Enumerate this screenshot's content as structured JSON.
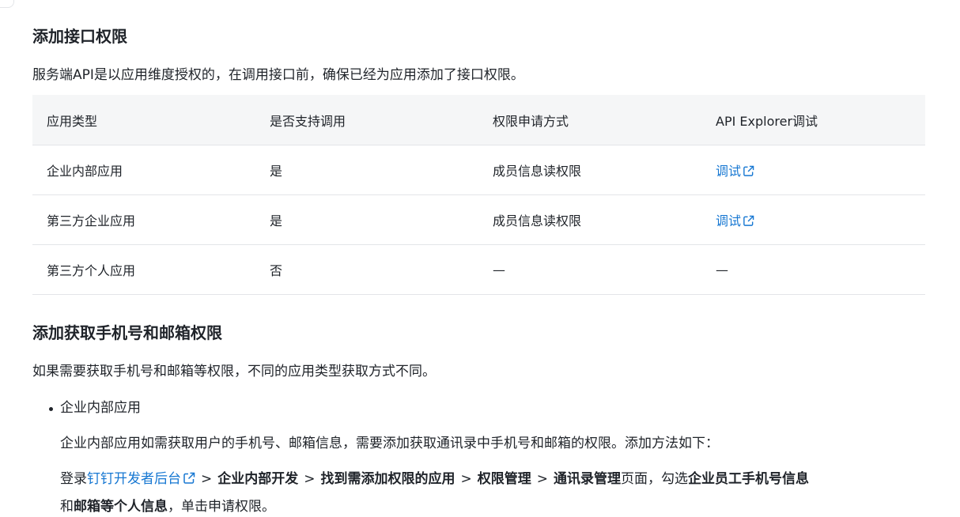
{
  "section1": {
    "title": "添加接口权限",
    "desc": "服务端API是以应用维度授权的，在调用接口前，确保已经为应用添加了接口权限。"
  },
  "table": {
    "headers": [
      "应用类型",
      "是否支持调用",
      "权限申请方式",
      "API Explorer调试"
    ],
    "rows": [
      {
        "type": "企业内部应用",
        "supported": "是",
        "method": "成员信息读权限",
        "debug": "调试",
        "debug_is_link": true
      },
      {
        "type": "第三方企业应用",
        "supported": "是",
        "method": "成员信息读权限",
        "debug": "调试",
        "debug_is_link": true
      },
      {
        "type": "第三方个人应用",
        "supported": "否",
        "method": "—",
        "debug": "—",
        "debug_is_link": false
      }
    ]
  },
  "section2": {
    "title": "添加获取手机号和邮箱权限",
    "desc": "如果需要获取手机号和邮箱等权限，不同的应用类型获取方式不同。",
    "bullet": "企业内部应用",
    "bullet_desc": "企业内部应用如需获取用户的手机号、邮箱信息，需要添加获取通讯录中手机号和邮箱的权限。添加方法如下：",
    "step": {
      "prefix": "登录",
      "link": "钉钉开发者后台",
      "sep": ">",
      "path1": "企业内部开发",
      "path2": "找到需添加权限的应用",
      "path3": "权限管理",
      "path4": "通讯录管理",
      "mid": "页面，勾选",
      "bold1": "企业员工手机号信息",
      "and": "和",
      "bold2": "邮箱等个人信息",
      "suffix": "，单击申请权限。"
    }
  },
  "colors": {
    "link": "#1677d2",
    "text": "#1f2329",
    "header_bg": "#f5f6f7",
    "border": "#e3e5e8"
  },
  "icons": [
    "external-link-icon"
  ]
}
